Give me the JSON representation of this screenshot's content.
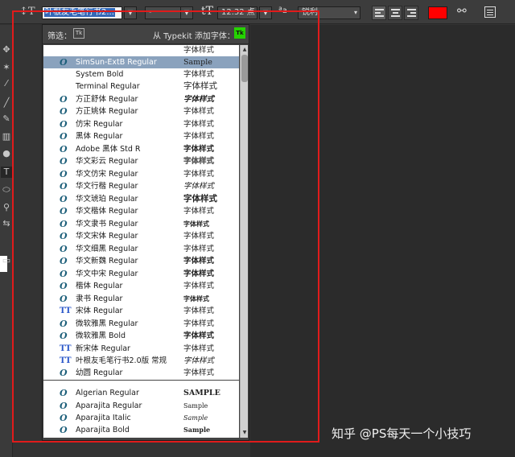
{
  "options_bar": {
    "font_family": "叶根友毛笔行书2...",
    "font_style": "-",
    "font_size": "12.32 点",
    "aa_label": "ªa",
    "antialias": "锐利",
    "text_color": "#ff0000"
  },
  "panel": {
    "filter_label": "筛选：",
    "tk_badge": "Tk",
    "typekit_label": "从 Typekit 添加字体：",
    "fonts": [
      {
        "icon": "",
        "name": "",
        "sample": "字体样式"
      },
      {
        "icon": "opentype-icon",
        "name": "SimSun-ExtB Regular",
        "sample": "Sample"
      },
      {
        "icon": "",
        "name": "System Bold",
        "sample": "字体样式"
      },
      {
        "icon": "",
        "name": "Terminal Regular",
        "sample": "字体样式"
      },
      {
        "icon": "opentype-icon",
        "name": "方正舒体 Regular",
        "sample": "字体样式"
      },
      {
        "icon": "opentype-icon",
        "name": "方正姚体 Regular",
        "sample": "字体样式"
      },
      {
        "icon": "opentype-icon",
        "name": "仿宋 Regular",
        "sample": "字体样式"
      },
      {
        "icon": "opentype-icon",
        "name": "黑体 Regular",
        "sample": "字体样式"
      },
      {
        "icon": "opentype-icon",
        "name": "Adobe 黑体 Std R",
        "sample": "字体样式"
      },
      {
        "icon": "opentype-icon",
        "name": "华文彩云 Regular",
        "sample": "字体样式"
      },
      {
        "icon": "opentype-icon",
        "name": "华文仿宋 Regular",
        "sample": "字体样式"
      },
      {
        "icon": "opentype-icon",
        "name": "华文行楷 Regular",
        "sample": "字体样式"
      },
      {
        "icon": "opentype-icon",
        "name": "华文琥珀 Regular",
        "sample": "字体样式"
      },
      {
        "icon": "opentype-icon",
        "name": "华文楷体 Regular",
        "sample": "字体样式"
      },
      {
        "icon": "opentype-icon",
        "name": "华文隶书 Regular",
        "sample": "字体样式"
      },
      {
        "icon": "opentype-icon",
        "name": "华文宋体 Regular",
        "sample": "字体样式"
      },
      {
        "icon": "opentype-icon",
        "name": "华文细黑 Regular",
        "sample": "字体样式"
      },
      {
        "icon": "opentype-icon",
        "name": "华文新魏 Regular",
        "sample": "字体样式"
      },
      {
        "icon": "opentype-icon",
        "name": "华文中宋 Regular",
        "sample": "字体样式"
      },
      {
        "icon": "opentype-icon",
        "name": "楷体 Regular",
        "sample": "字体样式"
      },
      {
        "icon": "opentype-icon",
        "name": "隶书 Regular",
        "sample": "字体样式"
      },
      {
        "icon": "truetype-icon",
        "name": "宋体 Regular",
        "sample": "字体样式"
      },
      {
        "icon": "opentype-icon",
        "name": "微软雅黑 Regular",
        "sample": "字体样式"
      },
      {
        "icon": "opentype-icon",
        "name": "微软雅黑 Bold",
        "sample": "字体样式"
      },
      {
        "icon": "truetype-icon",
        "name": "新宋体 Regular",
        "sample": "字体样式"
      },
      {
        "icon": "truetype-icon",
        "name": "叶根友毛笔行书2.0版 常规",
        "sample": "字体样式"
      },
      {
        "icon": "opentype-icon",
        "name": "幼圆 Regular",
        "sample": "字体样式"
      },
      {
        "icon": "opentype-icon",
        "name": "Algerian Regular",
        "sample": "SAMPLE"
      },
      {
        "icon": "opentype-icon",
        "name": "Aparajita Regular",
        "sample": "Sample"
      },
      {
        "icon": "opentype-icon",
        "name": "Aparajita Italic",
        "sample": "Sample"
      },
      {
        "icon": "opentype-icon",
        "name": "Aparajita Bold",
        "sample": "Sample"
      }
    ]
  },
  "watermark": "知乎 @PS每天一个小技巧"
}
